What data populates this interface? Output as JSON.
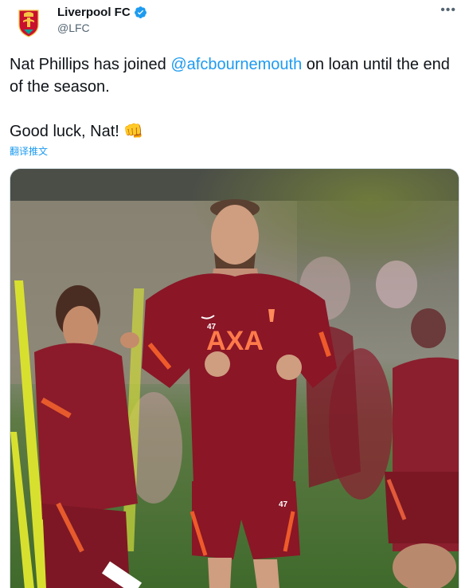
{
  "account": {
    "name": "Liverpool FC",
    "handle": "@LFC",
    "avatar_icon": "lfc-crest-icon",
    "verified_icon": "verified-badge-icon"
  },
  "more_icon": "more-options-icon",
  "tweet": {
    "part1": "Nat Phillips has joined ",
    "mention": "@afcbournemouth",
    "part2": " on loan until the end of the season.",
    "line2": "Good luck, Nat! ",
    "emoji": "👊"
  },
  "translate_label": "翻译推文",
  "photo": {
    "kit_text": "AXA",
    "number": "47",
    "description_icon": "training-photo"
  },
  "colors": {
    "link": "#1d9bf0",
    "verified": "#1d9bf0",
    "kit_red": "#8a1626"
  }
}
